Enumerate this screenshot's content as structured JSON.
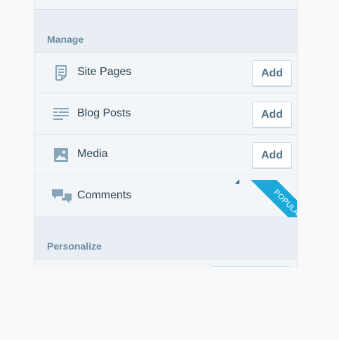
{
  "sections": {
    "manage": {
      "title": "Manage"
    },
    "personalize": {
      "title": "Personalize"
    }
  },
  "rows": [
    {
      "label": "Site Pages",
      "icon": "page-icon",
      "action": "Add"
    },
    {
      "label": "Blog Posts",
      "icon": "posts-icon",
      "action": "Add"
    },
    {
      "label": "Media",
      "icon": "image-icon",
      "action": "Add"
    },
    {
      "label": "Comments",
      "icon": "comments-icon",
      "badge": "POPULAR"
    }
  ],
  "colors": {
    "panel_bg": "#f3f6f8",
    "header_bg": "#e8eef3",
    "header_text": "#6b8aa3",
    "label_text": "#2e4453",
    "icon": "#87a6bc",
    "button_text": "#4f748e",
    "ribbon": "#1ba9dc"
  }
}
